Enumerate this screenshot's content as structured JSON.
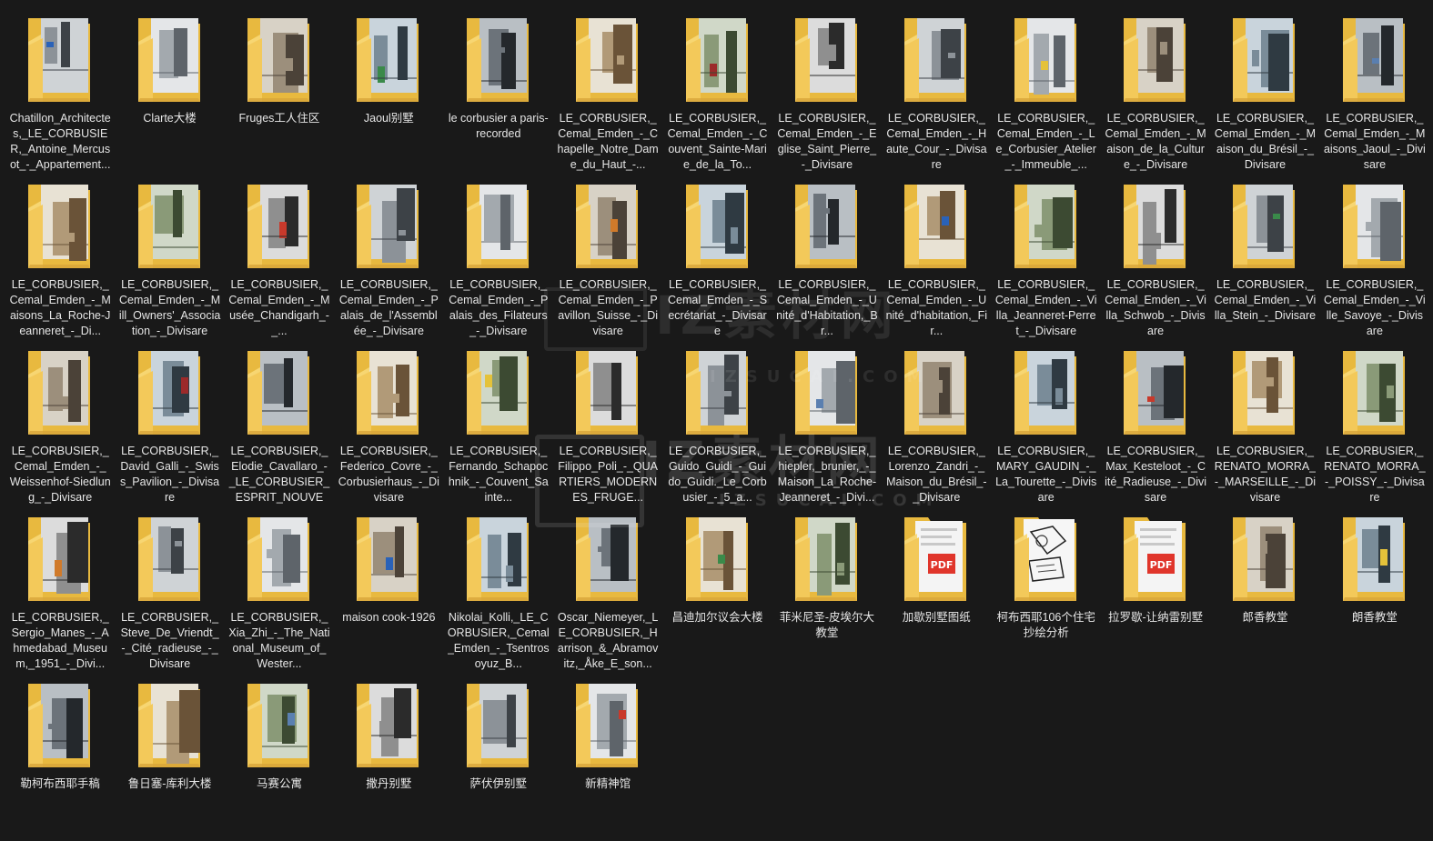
{
  "watermark": {
    "main": "IZ素材网",
    "sub": "IZSUCAI.COM"
  },
  "colors": {
    "background": "#191919",
    "folder_back": "#e8b93f",
    "folder_front": "#f8d775",
    "label_text": "#e6e6e6"
  },
  "folders": [
    {
      "name": "Chatillon_Architectes,_LE_CORBUSIER,_Antoine_Mercusot_-_Appartement...",
      "thumb": "photo"
    },
    {
      "name": "Clarte大楼",
      "thumb": "photo"
    },
    {
      "name": "Fruges工人住区",
      "thumb": "photo"
    },
    {
      "name": "Jaoul别墅",
      "thumb": "photo"
    },
    {
      "name": "le corbusier a paris-recorded",
      "thumb": "photo"
    },
    {
      "name": "LE_CORBUSIER,_Cemal_Emden_-_Chapelle_Notre_Dame_du_Haut_-...",
      "thumb": "photo"
    },
    {
      "name": "LE_CORBUSIER,_Cemal_Emden_-_Couvent_Sainte-Marie_de_la_To...",
      "thumb": "photo"
    },
    {
      "name": "LE_CORBUSIER,_Cemal_Emden_-_Eglise_Saint_Pierre_-_Divisare",
      "thumb": "photo"
    },
    {
      "name": "LE_CORBUSIER,_Cemal_Emden_-_Haute_Cour_-_Divisare",
      "thumb": "photo"
    },
    {
      "name": "LE_CORBUSIER,_Cemal_Emden_-_Le_Corbusier_Atelier_-_Immeuble_...",
      "thumb": "photo"
    },
    {
      "name": "LE_CORBUSIER,_Cemal_Emden_-_Maison_de_la_Culture_-_Divisare",
      "thumb": "photo"
    },
    {
      "name": "LE_CORBUSIER,_Cemal_Emden_-_Maison_du_Brésil_-_Divisare",
      "thumb": "photo"
    },
    {
      "name": "LE_CORBUSIER,_Cemal_Emden_-_Maisons_Jaoul_-_Divisare",
      "thumb": "photo"
    },
    {
      "name": "LE_CORBUSIER,_Cemal_Emden_-_Maisons_La_Roche-Jeanneret_-_Di...",
      "thumb": "photo"
    },
    {
      "name": "LE_CORBUSIER,_Cemal_Emden_-_Mill_Owners'_Association_-_Divisare",
      "thumb": "photo"
    },
    {
      "name": "LE_CORBUSIER,_Cemal_Emden_-_Musée_Chandigarh_-_...",
      "thumb": "photo"
    },
    {
      "name": "LE_CORBUSIER,_Cemal_Emden_-_Palais_de_l'Assemblée_-_Divisare",
      "thumb": "photo"
    },
    {
      "name": "LE_CORBUSIER,_Cemal_Emden_-_Palais_des_Filateurs_-_Divisare",
      "thumb": "photo"
    },
    {
      "name": "LE_CORBUSIER,_Cemal_Emden_-_Pavillon_Suisse_-_Divisare",
      "thumb": "photo"
    },
    {
      "name": "LE_CORBUSIER,_Cemal_Emden_-_Secrétariat_-_Divisare",
      "thumb": "photo"
    },
    {
      "name": "LE_CORBUSIER,_Cemal_Emden_-_Unité_d'Habitation,_Br...",
      "thumb": "photo"
    },
    {
      "name": "LE_CORBUSIER,_Cemal_Emden_-_Unité_d'habitation,_Fir...",
      "thumb": "photo"
    },
    {
      "name": "LE_CORBUSIER,_Cemal_Emden_-_Villa_Jeanneret-Perret_-_Divisare",
      "thumb": "photo"
    },
    {
      "name": "LE_CORBUSIER,_Cemal_Emden_-_Villa_Schwob_-_Divisare",
      "thumb": "photo"
    },
    {
      "name": "LE_CORBUSIER,_Cemal_Emden_-_Villa_Stein_-_Divisare",
      "thumb": "photo"
    },
    {
      "name": "LE_CORBUSIER,_Cemal_Emden_-_Ville_Savoye_-_Divisare",
      "thumb": "photo"
    },
    {
      "name": "LE_CORBUSIER,_Cemal_Emden_-_Weissenhof-Siedlung_-_Divisare",
      "thumb": "photo"
    },
    {
      "name": "LE_CORBUSIER,_David_Galli_-_Swiss_Pavilion_-_Divisare",
      "thumb": "photo"
    },
    {
      "name": "LE_CORBUSIER,_Elodie_Cavallaro_-_LE_CORBUSIER_ESPRIT_NOUVEA...",
      "thumb": "photo"
    },
    {
      "name": "LE_CORBUSIER,_Federico_Covre_-_Corbusierhaus_-_Divisare",
      "thumb": "photo"
    },
    {
      "name": "LE_CORBUSIER,_Fernando_Schapochnik_-_Couvent_Sainte...",
      "thumb": "photo"
    },
    {
      "name": "LE_CORBUSIER,_Filippo_Poli_-_QUARTIERS_MODERNES_FRUGE...",
      "thumb": "photo"
    },
    {
      "name": "LE_CORBUSIER,_Guido_Guidi_-_Guido_Guidi._Le_Corbusier_-_5_a...",
      "thumb": "photo"
    },
    {
      "name": "LE_CORBUSIER,_hiepler,_brunier,_-_Maison_La_Roche-Jeanneret_-_Divi...",
      "thumb": "photo"
    },
    {
      "name": "LE_CORBUSIER,_Lorenzo_Zandri_-_Maison_du_Brésil_-_Divisare",
      "thumb": "photo"
    },
    {
      "name": "LE_CORBUSIER,_MARY_GAUDIN_-_La_Tourette_-_Divisare",
      "thumb": "photo"
    },
    {
      "name": "LE_CORBUSIER,_Max_Kesteloot_-_Cité_Radieuse_-_Divisare",
      "thumb": "photo"
    },
    {
      "name": "LE_CORBUSIER,_RENATO_MORRA_-_MARSEILLE_-_Divisare",
      "thumb": "photo"
    },
    {
      "name": "LE_CORBUSIER,_RENATO_MORRA_-_POISSY_-_Divisare",
      "thumb": "photo"
    },
    {
      "name": "LE_CORBUSIER,_Sergio_Manes_-_Ahmedabad_Museum,_1951_-_Divi...",
      "thumb": "photo"
    },
    {
      "name": "LE_CORBUSIER,_Steve_De_Vriendt_-_Cité_radieuse_-_Divisare",
      "thumb": "photo"
    },
    {
      "name": "LE_CORBUSIER,_Xia_Zhi_-_The_National_Museum_of_Wester...",
      "thumb": "photo"
    },
    {
      "name": "maison cook-1926",
      "thumb": "photo"
    },
    {
      "name": "Nikolai_Kolli,_LE_CORBUSIER,_Cemal_Emden_-_Tsentrosoyuz_B...",
      "thumb": "photo"
    },
    {
      "name": "Oscar_Niemeyer,_LE_CORBUSIER,_Harrison_&_Abramovitz,_Åke_E_son...",
      "thumb": "photo"
    },
    {
      "name": "昌迪加尔议会大楼",
      "thumb": "photo"
    },
    {
      "name": "菲米尼圣-皮埃尔大教堂",
      "thumb": "photo"
    },
    {
      "name": "加歇别墅图纸",
      "thumb": "pdf"
    },
    {
      "name": "柯布西耶106个住宅抄绘分析",
      "thumb": "sketch"
    },
    {
      "name": "拉罗歇-让纳雷别墅",
      "thumb": "pdf"
    },
    {
      "name": "郎香教堂",
      "thumb": "photo"
    },
    {
      "name": "朗香教堂",
      "thumb": "photo"
    },
    {
      "name": "勒柯布西耶手稿",
      "thumb": "photo"
    },
    {
      "name": "鲁日塞-库利大楼",
      "thumb": "photo"
    },
    {
      "name": "马赛公寓",
      "thumb": "photo"
    },
    {
      "name": "撒丹别墅",
      "thumb": "photo"
    },
    {
      "name": "萨伏伊别墅",
      "thumb": "photo"
    },
    {
      "name": "新精神馆",
      "thumb": "photo"
    }
  ]
}
